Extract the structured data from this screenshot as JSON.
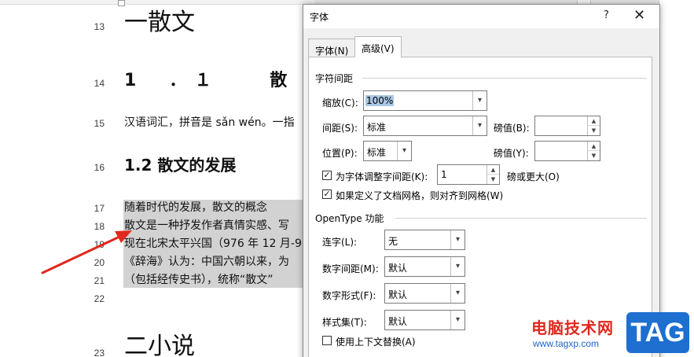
{
  "document": {
    "lines": [
      {
        "num": "13",
        "text": "一散文"
      },
      {
        "num": "14",
        "text": "1　．１　　散　　"
      },
      {
        "num": "15",
        "text": "汉语词汇，拼音是 sǎn wén。一指"
      },
      {
        "num": "16",
        "text": "1.2 散文的发展"
      },
      {
        "num": "17",
        "text": "随着时代的发展，散文的概念"
      },
      {
        "num": "18",
        "text": "散文是一种抒发作者真情实感、写"
      },
      {
        "num": "19",
        "text": "现在北宋太平兴国（976 年 12 月-9"
      },
      {
        "num": "20",
        "text": "《辞海》认为：中国六朝以来，为"
      },
      {
        "num": "21",
        "text": "（包括经传史书），统称“散文”"
      },
      {
        "num": "22",
        "text": ""
      },
      {
        "num": "23",
        "text": "二小说"
      }
    ]
  },
  "dialog": {
    "title": "字体",
    "help": "?",
    "close": "✕",
    "tabs": [
      {
        "label": "字体(N)",
        "active": false
      },
      {
        "label": "高级(V)",
        "active": true
      }
    ],
    "spacing_section": "字符间距",
    "scale": {
      "label": "缩放(C):",
      "value": "100%"
    },
    "spacing": {
      "label": "间距(S):",
      "value": "标准",
      "points_label": "磅值(B):",
      "points_value": ""
    },
    "position": {
      "label": "位置(P):",
      "value": "标准",
      "points_label": "磅值(Y):",
      "points_value": ""
    },
    "kerning": {
      "checked": true,
      "label": "为字体调整字间距(K):",
      "value": "1",
      "suffix": "磅或更大(O)"
    },
    "snap_grid": {
      "checked": true,
      "label": "如果定义了文档网格，则对齐到网格(W)"
    },
    "opentype_section": "OpenType 功能",
    "ligatures": {
      "label": "连字(L):",
      "value": "无"
    },
    "num_spacing": {
      "label": "数字间距(M):",
      "value": "默认"
    },
    "num_forms": {
      "label": "数字形式(F):",
      "value": "默认"
    },
    "stylistic_sets": {
      "label": "样式集(T):",
      "value": "默认"
    },
    "contextual_alt": {
      "checked": false,
      "label": "使用上下文替换(A)"
    }
  },
  "watermark": {
    "site_name": "电脑技术网",
    "url": "www.tagxp.com",
    "badge": "TAG"
  },
  "colors": {
    "highlight": "#d2d2d2",
    "arrow": "#e0281e",
    "selection": "#a8c7e6",
    "badge": "#1e6fd0"
  }
}
